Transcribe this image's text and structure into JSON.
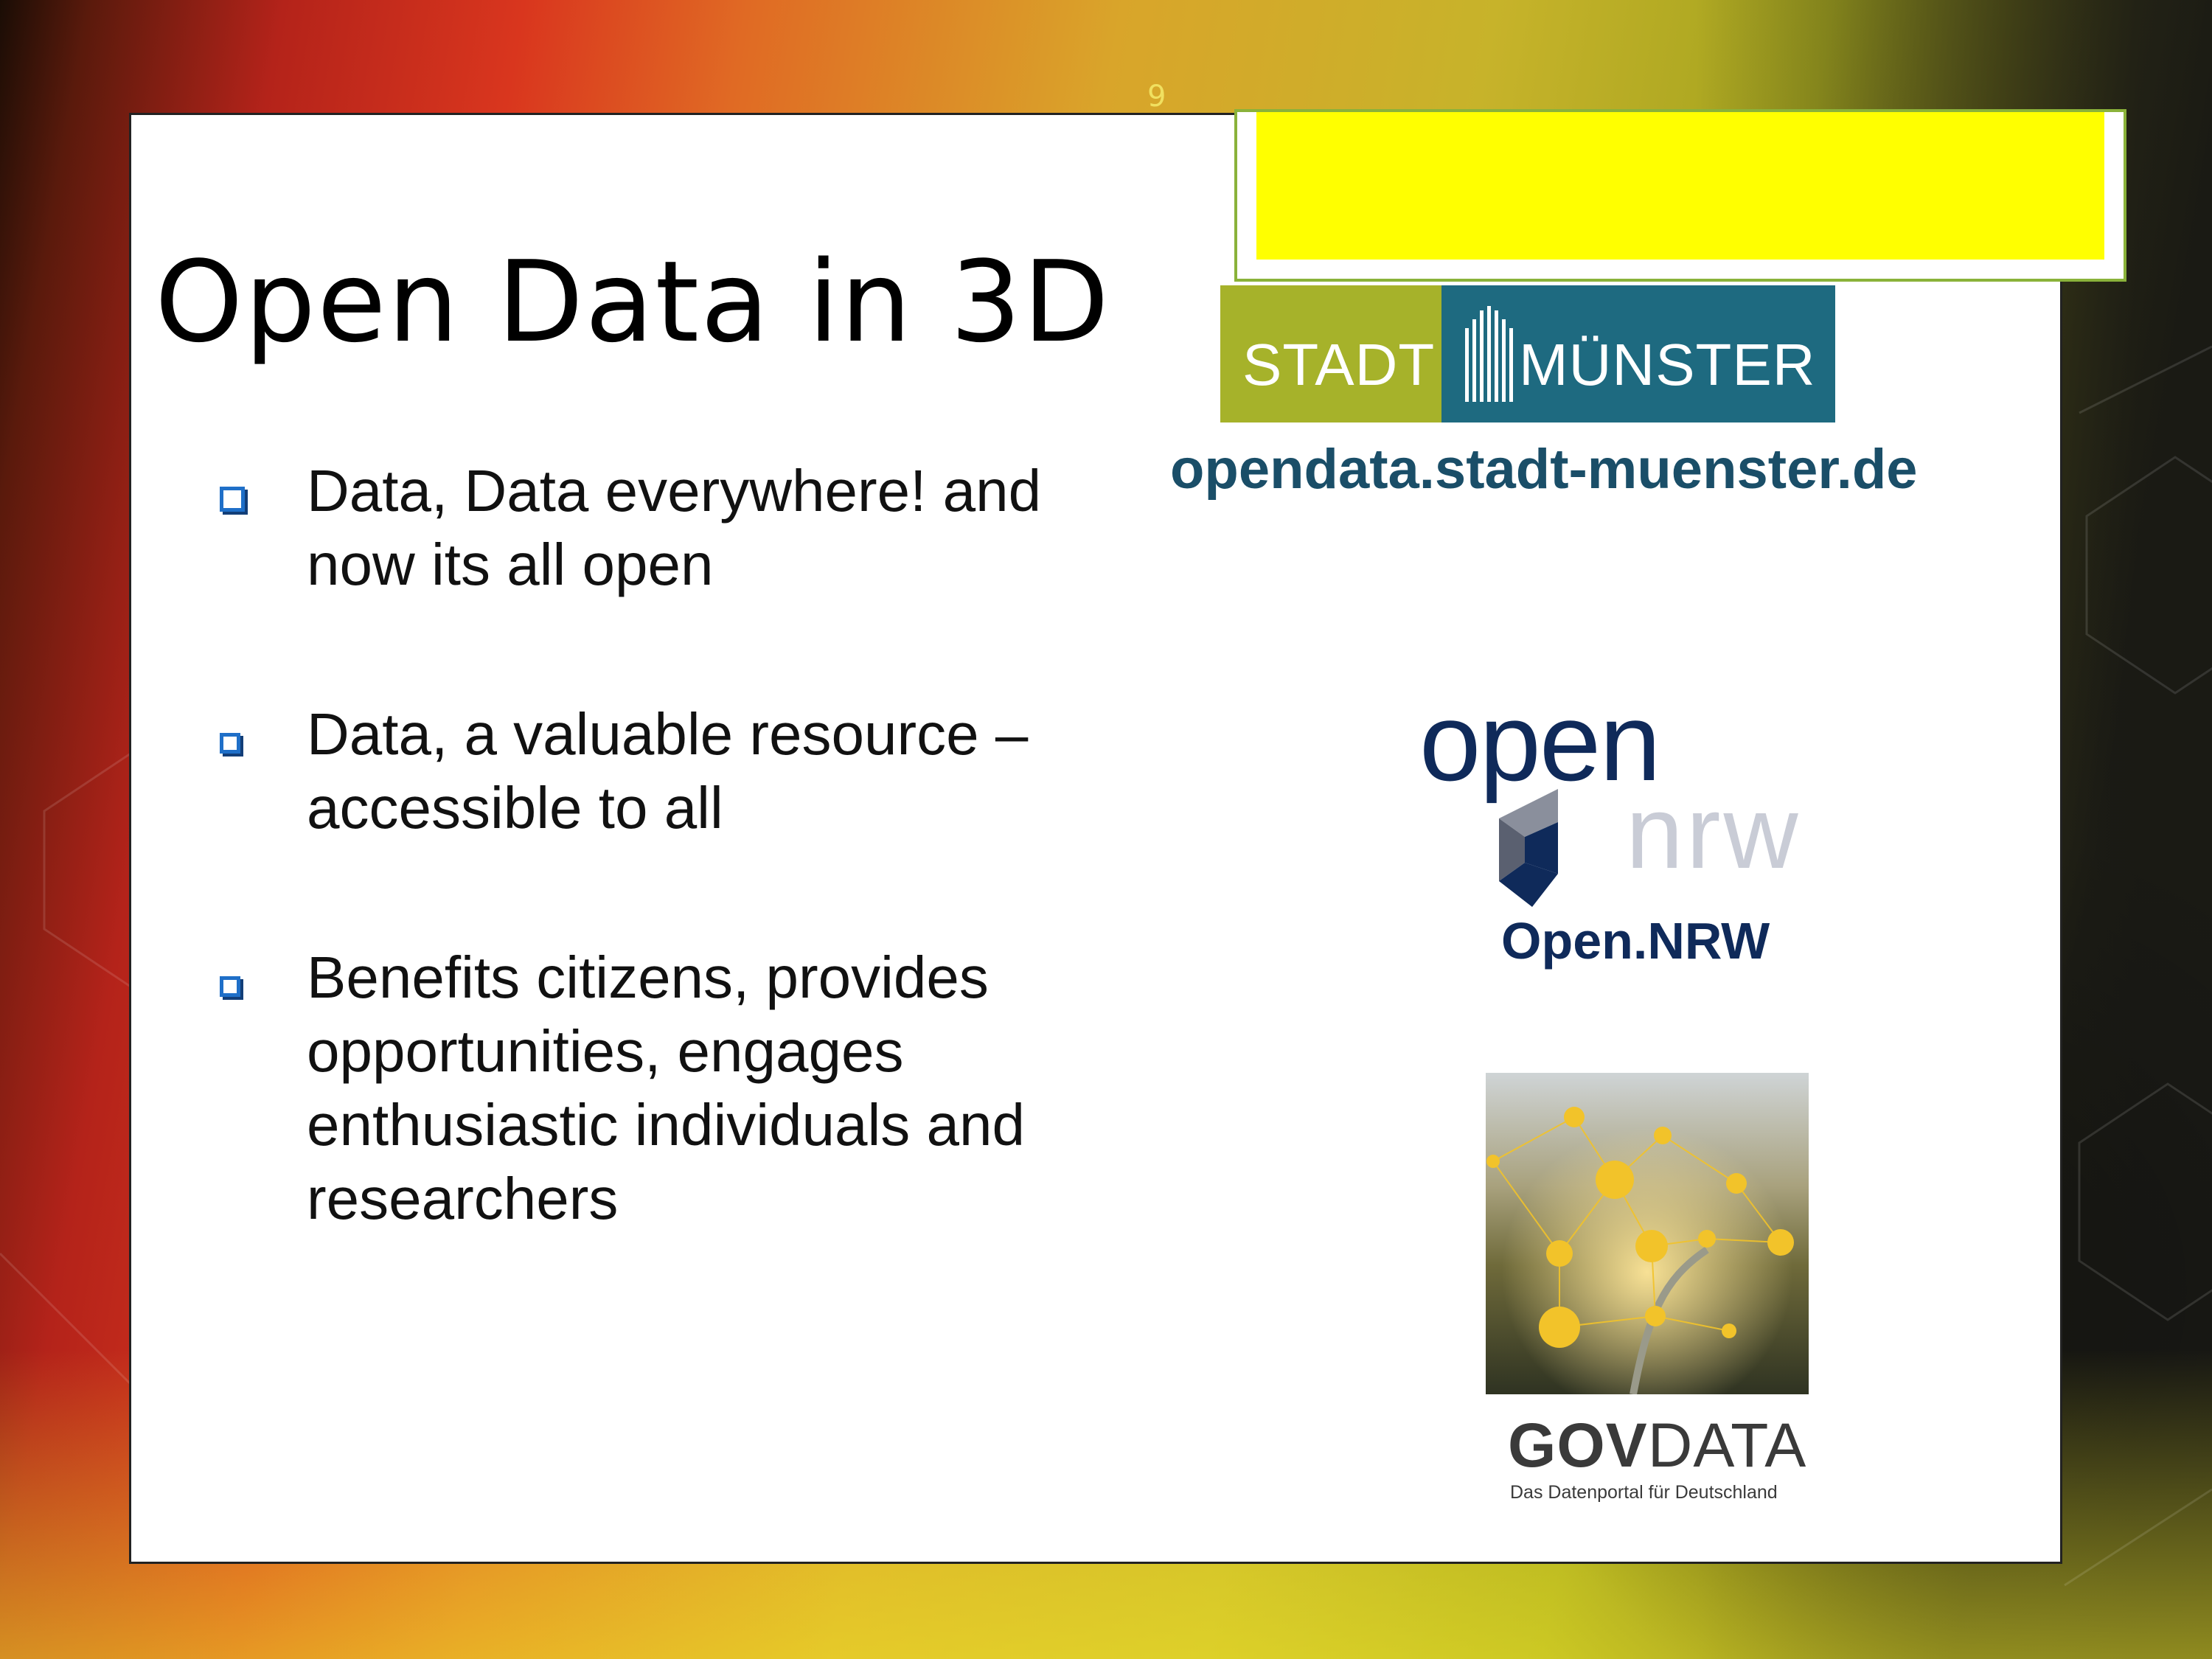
{
  "slide": {
    "number": "9",
    "title": "Open Data in 3D"
  },
  "bullets": [
    {
      "line1": "Data, Data everywhere! and",
      "line2": "now its all open"
    },
    {
      "line1": "Data, a valuable resource –",
      "line2": "accessible to all"
    },
    {
      "line1": "Benefits citizens, provides",
      "line2": "opportunities, engages",
      "line3": "enthusiastic individuals and",
      "line4": "researchers"
    }
  ],
  "logos": {
    "muenster": {
      "left": "STADT",
      "right": "MÜNSTER",
      "url": "opendata.stadt-muenster.de"
    },
    "opennrw": {
      "open": "open",
      "nrw": "nrw",
      "label": "Open.NRW"
    },
    "govdata": {
      "bold": "GOV",
      "regular": "DATA",
      "subtitle": "Das Datenportal für Deutschland"
    }
  },
  "colors": {
    "accent_box": "#ffff00",
    "bullet_icon": "#1f6fc8",
    "muenster_green": "#a6b22a",
    "muenster_blue": "#1e6a80",
    "nrw_navy": "#0f2a5a"
  },
  "icons": {
    "bullet": "checkbox-bullet-icon"
  }
}
